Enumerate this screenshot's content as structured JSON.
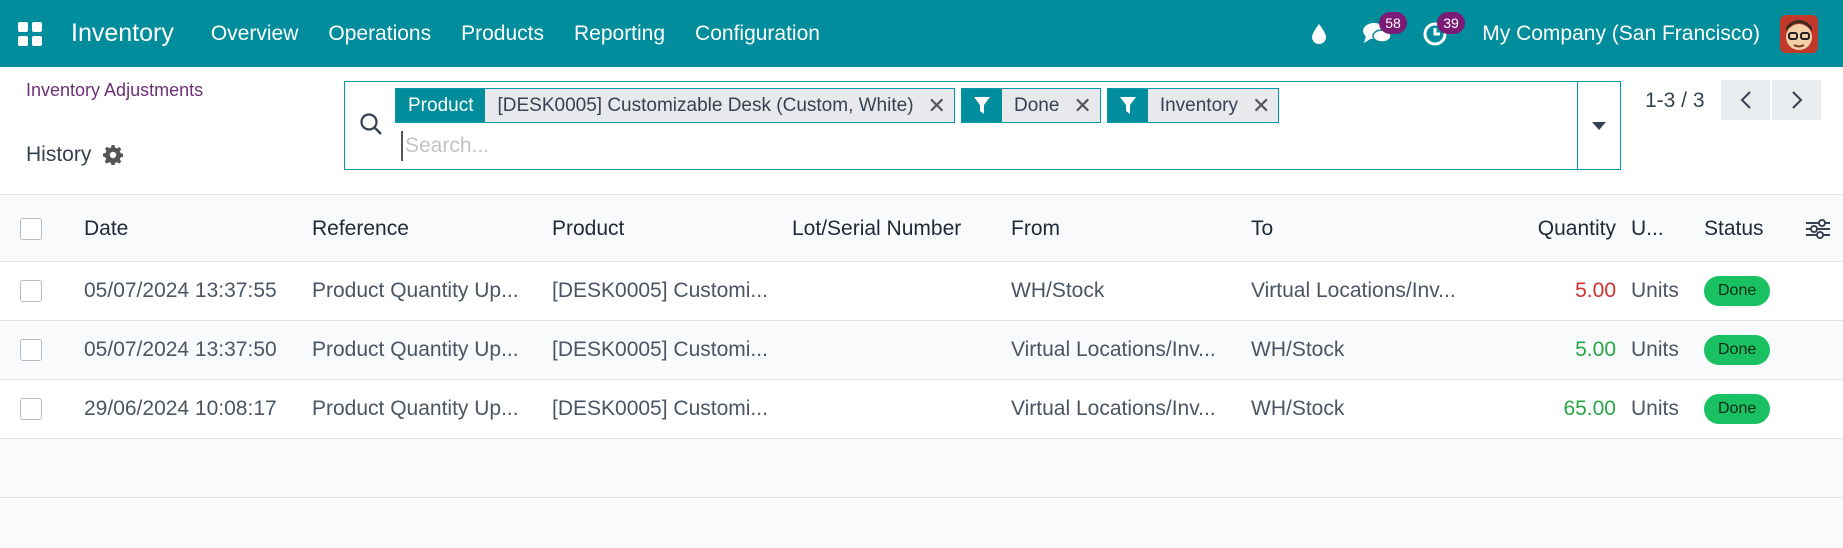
{
  "nav": {
    "brand": "Inventory",
    "menu": [
      "Overview",
      "Operations",
      "Products",
      "Reporting",
      "Configuration"
    ],
    "messages_count": "58",
    "activities_count": "39",
    "company": "My Company (San Francisco)",
    "bg_color": "#018d9c",
    "badge_color": "#7a1b76"
  },
  "control": {
    "breadcrumb": "Inventory Adjustments",
    "title": "History",
    "search": {
      "placeholder": "Search...",
      "facets": [
        {
          "type": "field",
          "label": "Product",
          "value": "[DESK0005] Customizable Desk (Custom, White)"
        },
        {
          "type": "filter",
          "icon": "filter-icon",
          "value": "Done"
        },
        {
          "type": "filter",
          "icon": "filter-icon",
          "value": "Inventory"
        }
      ]
    },
    "pager": "1-3 / 3"
  },
  "table": {
    "columns": [
      "Date",
      "Reference",
      "Product",
      "Lot/Serial Number",
      "From",
      "To",
      "Quantity",
      "U...",
      "Status"
    ],
    "rows": [
      {
        "date": "05/07/2024 13:37:55",
        "reference": "Product Quantity Up...",
        "product": "[DESK0005] Customi...",
        "lot": "",
        "from": "WH/Stock",
        "to": "Virtual Locations/Inv...",
        "quantity": "5.00",
        "qty_sign": "negative",
        "uom": "Units",
        "status": "Done"
      },
      {
        "date": "05/07/2024 13:37:50",
        "reference": "Product Quantity Up...",
        "product": "[DESK0005] Customi...",
        "lot": "",
        "from": "Virtual Locations/Inv...",
        "to": "WH/Stock",
        "quantity": "5.00",
        "qty_sign": "positive",
        "uom": "Units",
        "status": "Done"
      },
      {
        "date": "29/06/2024 10:08:17",
        "reference": "Product Quantity Up...",
        "product": "[DESK0005] Customi...",
        "lot": "",
        "from": "Virtual Locations/Inv...",
        "to": "WH/Stock",
        "quantity": "65.00",
        "qty_sign": "positive",
        "uom": "Units",
        "status": "Done"
      }
    ],
    "colors": {
      "negative": "#d32f2f",
      "positive": "#28a745",
      "done": "#1ac162"
    }
  }
}
